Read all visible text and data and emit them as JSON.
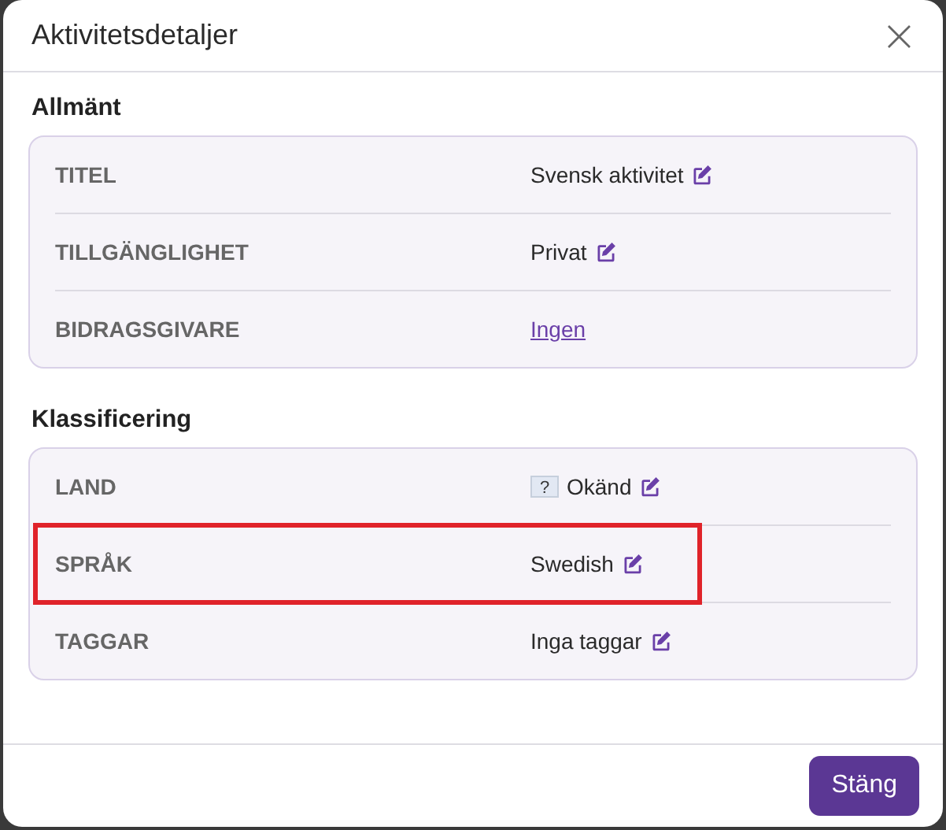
{
  "dialog": {
    "title": "Aktivitetsdetaljer",
    "close_label": "×"
  },
  "sections": [
    {
      "title": "Allmänt",
      "rows": [
        {
          "label": "TITEL",
          "kind": "text",
          "value": "Svensk aktivitet",
          "editable": true,
          "highlighted": false
        },
        {
          "label": "TILLGÄNGLIGHET",
          "kind": "text",
          "value": "Privat",
          "editable": true,
          "highlighted": false
        },
        {
          "label": "BIDRAGSGIVARE",
          "kind": "link",
          "value": "Ingen",
          "editable": false,
          "highlighted": false
        }
      ]
    },
    {
      "title": "Klassificering",
      "rows": [
        {
          "label": "LAND",
          "kind": "flag",
          "flag": "?",
          "value": "Okänd",
          "editable": true,
          "highlighted": false
        },
        {
          "label": "SPRÅK",
          "kind": "text",
          "value": "Swedish",
          "editable": true,
          "highlighted": true
        },
        {
          "label": "TAGGAR",
          "kind": "text",
          "value": "Inga taggar",
          "editable": true,
          "highlighted": false
        }
      ]
    }
  ],
  "buttons": [
    {
      "label": "Stäng"
    }
  ]
}
